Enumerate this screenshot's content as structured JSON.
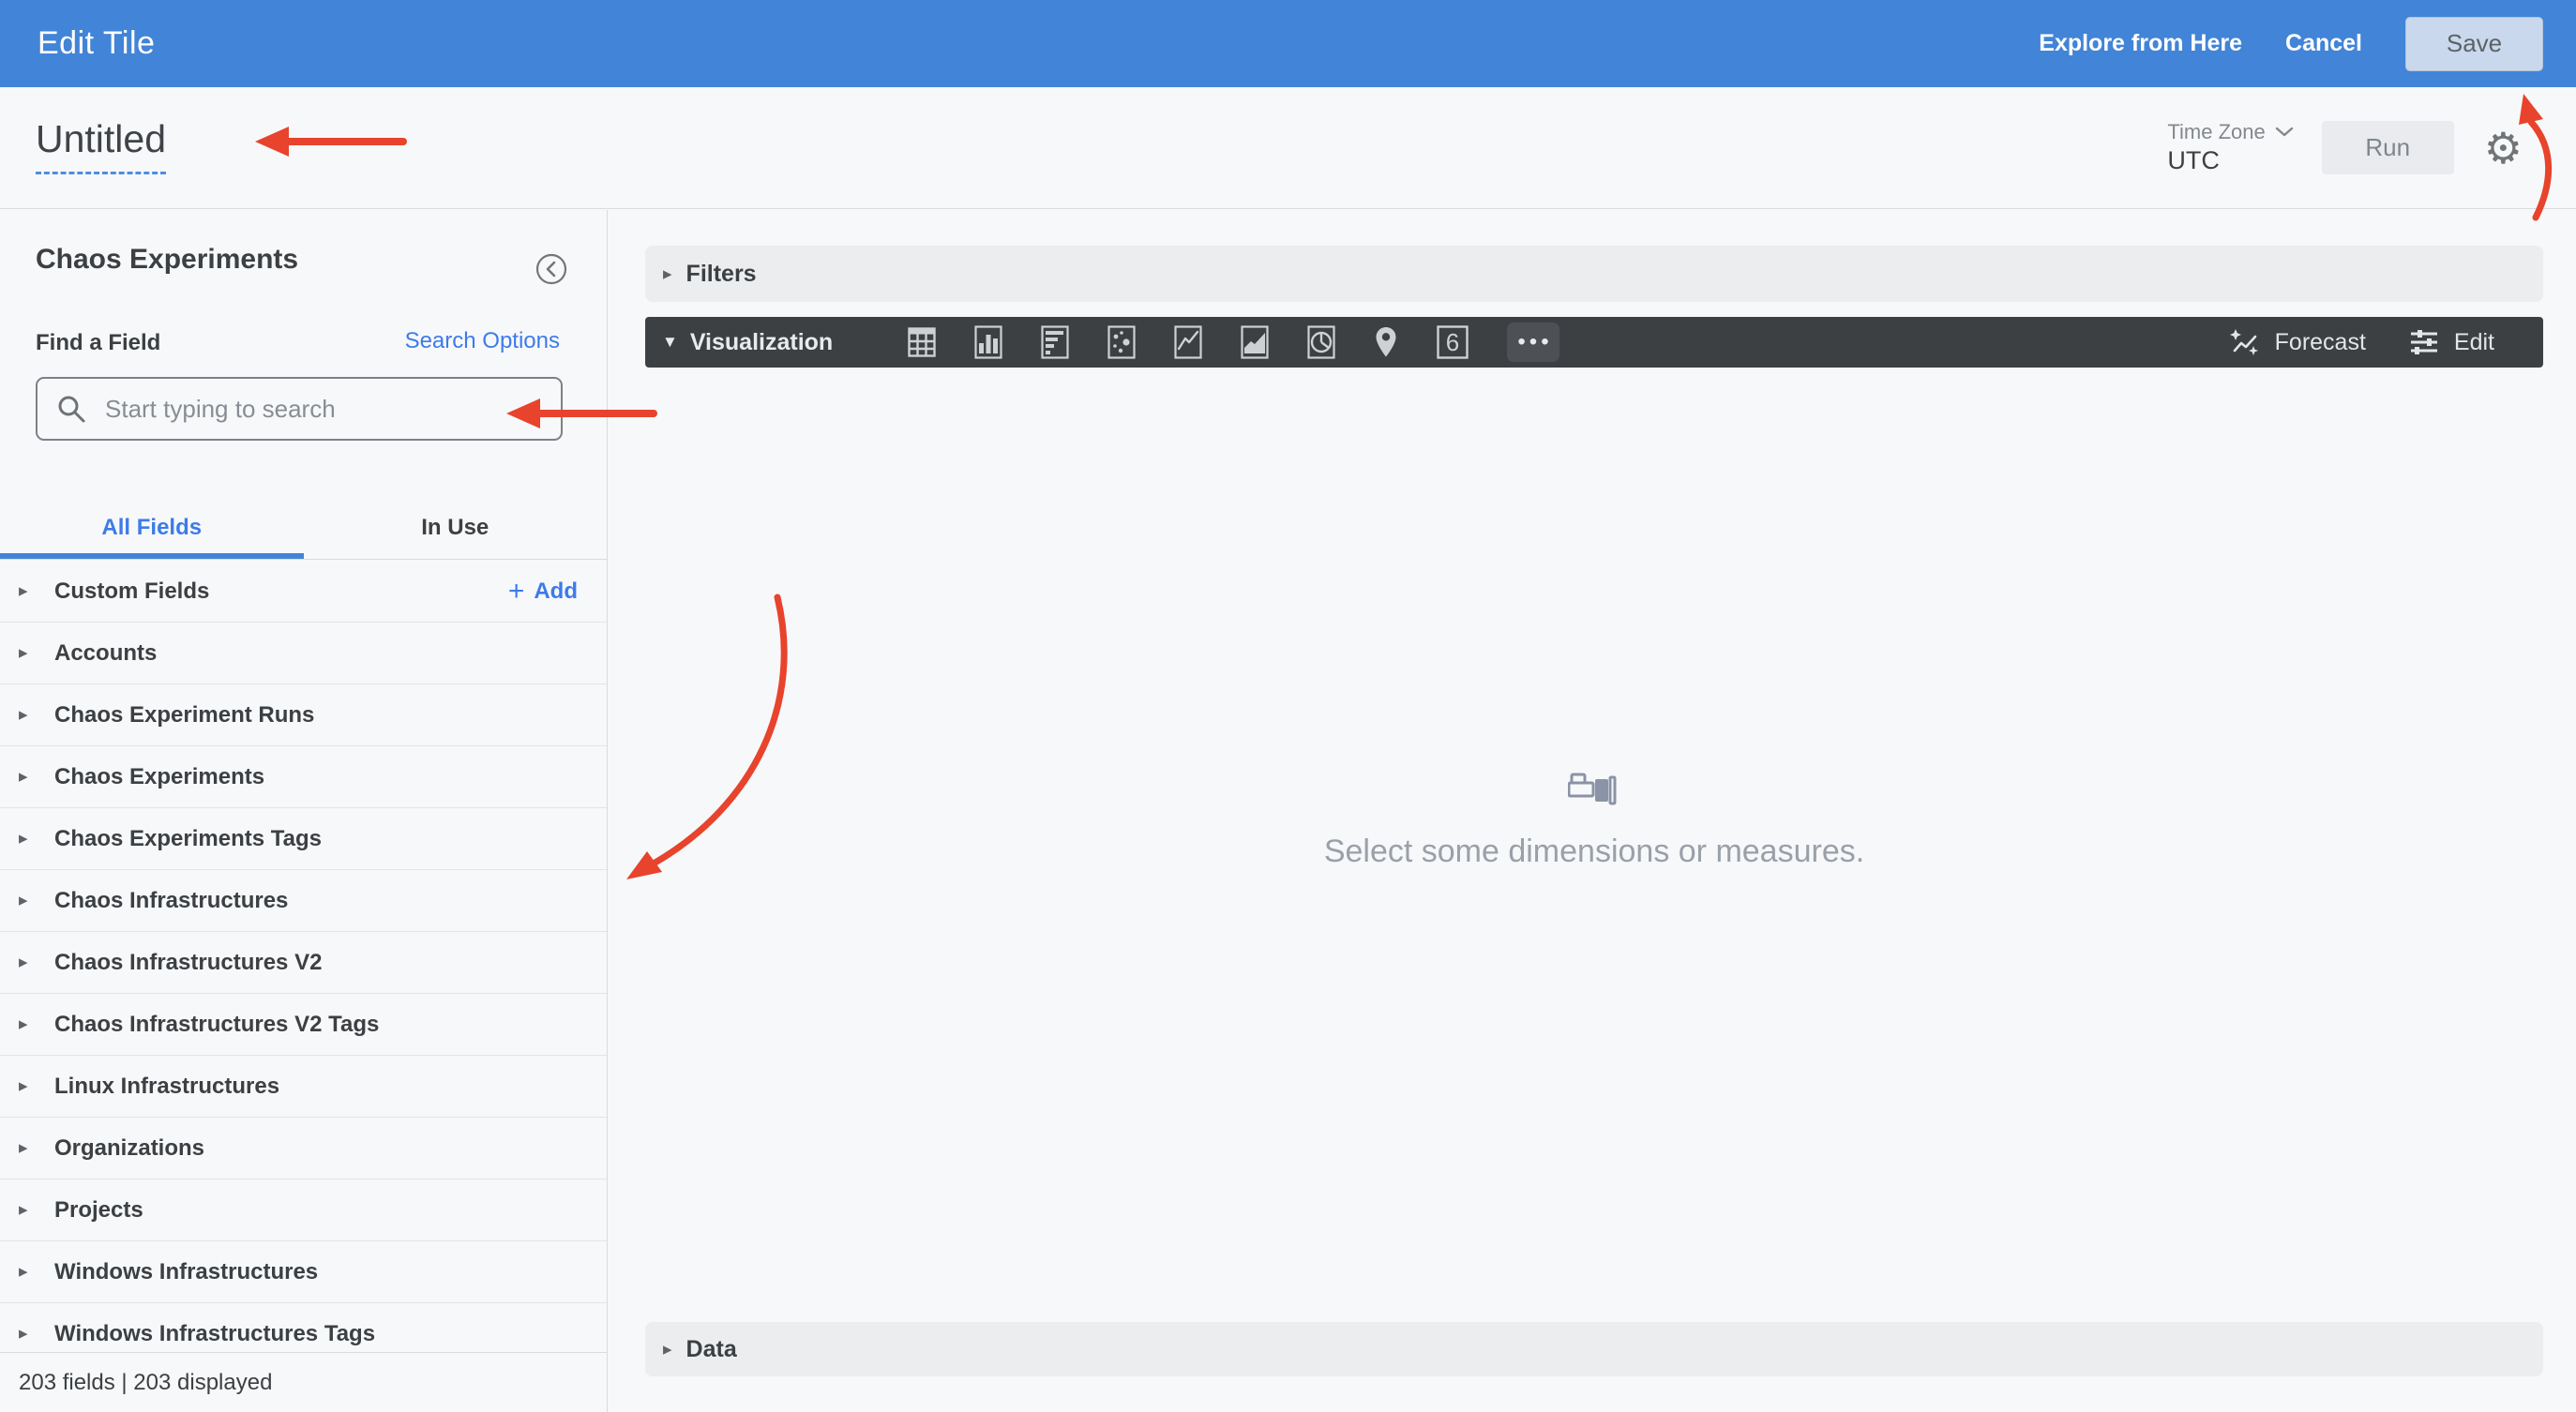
{
  "header": {
    "title": "Edit Tile",
    "explore_from_here": "Explore from Here",
    "cancel": "Cancel",
    "save": "Save"
  },
  "toolbar": {
    "tile_title": "Untitled",
    "timezone_label": "Time Zone",
    "timezone_value": "UTC",
    "run_label": "Run"
  },
  "sidebar": {
    "title": "Chaos Experiments",
    "find_a_field": "Find a Field",
    "search_options": "Search Options",
    "search_placeholder": "Start typing to search",
    "tabs": [
      {
        "label": "All Fields",
        "active": true
      },
      {
        "label": "In Use",
        "active": false
      }
    ],
    "custom_fields": {
      "label": "Custom Fields",
      "plus": "+",
      "add": "Add"
    },
    "groups": [
      "Accounts",
      "Chaos Experiment Runs",
      "Chaos Experiments",
      "Chaos Experiments Tags",
      "Chaos Infrastructures",
      "Chaos Infrastructures V2",
      "Chaos Infrastructures V2 Tags",
      "Linux Infrastructures",
      "Organizations",
      "Projects",
      "Windows Infrastructures",
      "Windows Infrastructures Tags"
    ],
    "footer": "203 fields | 203 displayed"
  },
  "main": {
    "filters": {
      "label": "Filters"
    },
    "visualization": {
      "label": "Visualization",
      "icons": [
        "table",
        "column-chart",
        "bar-chart",
        "scatter",
        "line-chart",
        "area-chart",
        "pie-chart",
        "map-pin",
        "single-value",
        "more"
      ],
      "single_value_glyph": "6",
      "more_dots": "•••",
      "forecast": "Forecast",
      "edit": "Edit"
    },
    "empty_state": "Select some dimensions or measures.",
    "data_panel": {
      "label": "Data"
    }
  },
  "glyphs": {
    "row_triangle": "▸",
    "viz_caret": "▼",
    "gear": "⚙"
  },
  "colors": {
    "header_blue": "#4284d7",
    "link_blue": "#3d7be9",
    "dark_bar": "#3d4043",
    "annotation_red": "#e8432c",
    "background": "#f7f8fa"
  }
}
